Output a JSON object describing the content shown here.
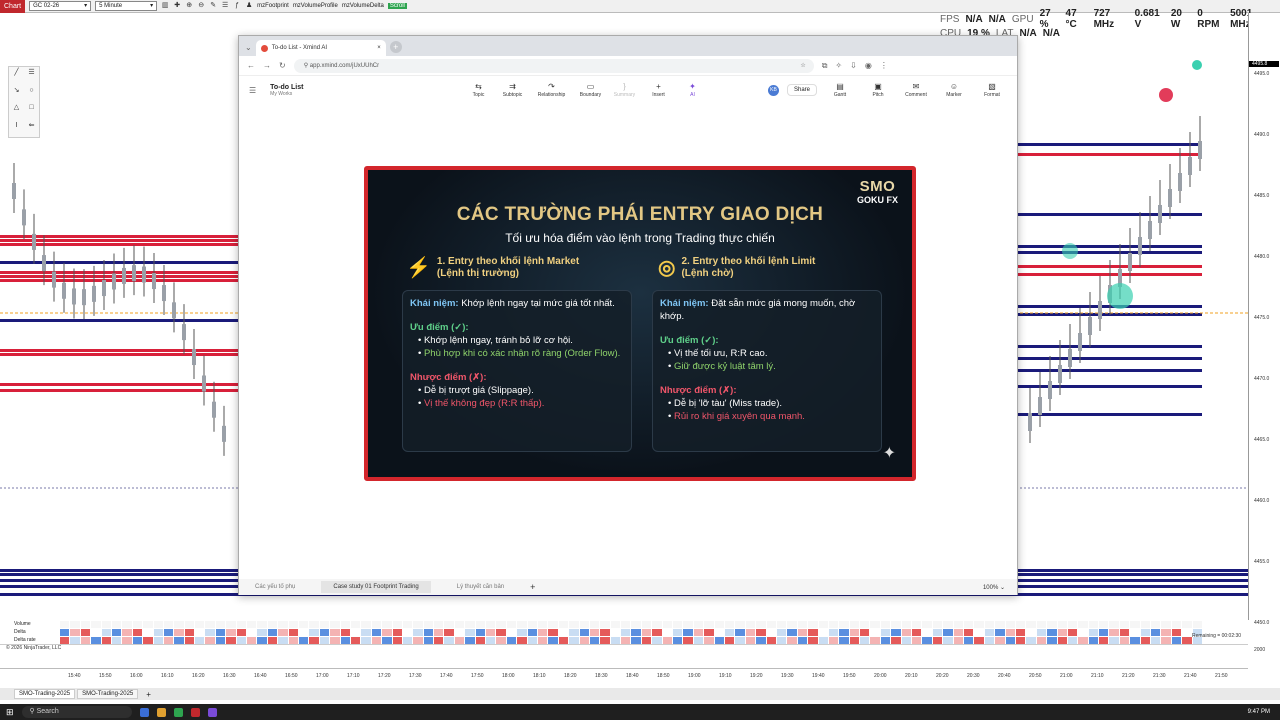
{
  "ninja": {
    "chart_tab": "Chart",
    "instrument": "GC 02-26",
    "timeframe": "5 Minute",
    "indicators": [
      "mzFootprint",
      "mzVolumeProfile",
      "mzVolumeDelta"
    ],
    "scroll_label": "Scroll",
    "copyright": "© 2026 NinjaTrader, LLC",
    "workspace_tabs": [
      "SMO-Trading-2025",
      "SMO-Trading-2025"
    ],
    "add_tab": "+",
    "row_labels": [
      "Volume",
      "Delta",
      "Delta rate"
    ],
    "price_ticks": [
      "4495.0",
      "4490.0",
      "4485.0",
      "4480.0",
      "4475.0",
      "4470.0",
      "4465.0",
      "4460.0",
      "4455.0",
      "4450.0"
    ],
    "current_price": "4495.8",
    "time_ticks": [
      "15:40",
      "15:50",
      "16:00",
      "16:10",
      "16:20",
      "16:30",
      "16:40",
      "16:50",
      "17:00",
      "17:10",
      "17:20",
      "17:30",
      "17:40",
      "17:50",
      "18:00",
      "18:10",
      "18:20",
      "18:30",
      "18:40",
      "18:50",
      "19:00",
      "19:10",
      "19:20",
      "19:30",
      "19:40",
      "19:50",
      "20:00",
      "20:10",
      "20:20",
      "20:30",
      "20:40",
      "20:50",
      "21:00",
      "21:10",
      "21:20",
      "21:30",
      "21:40",
      "21:50"
    ],
    "right_axis_bottom": "2000",
    "remaining_label": "Remaining = 00:02:30"
  },
  "perf": {
    "fps_label": "FPS",
    "fps_value": "N/A",
    "fps_value2": "N/A",
    "gpu_label": "GPU",
    "gpu_load": "27 %",
    "gpu_temp": "47 °C",
    "gpu_clock": "727 MHz",
    "gpu_volt": "0.681 V",
    "gpu_power": "20 W",
    "gpu_rpm": "0 RPM",
    "gpu_mem": "5001 MHz",
    "cpu_label": "CPU",
    "cpu_load": "19 %",
    "lat_label": "LAT",
    "lat_value": "N/A",
    "lat_value2": "N/A"
  },
  "browser": {
    "tab_title": "To-do List - Xmind AI",
    "url": "app.xmind.com/jUxUUhCr",
    "new_tab": "+"
  },
  "xmind": {
    "doc_title": "To-do List",
    "doc_sub": "My Works",
    "tools": [
      {
        "label": "Topic",
        "icon": "⇆"
      },
      {
        "label": "Subtopic",
        "icon": "⇉"
      },
      {
        "label": "Relationship",
        "icon": "↷"
      },
      {
        "label": "Boundary",
        "icon": "▭"
      },
      {
        "label": "Summary",
        "icon": "}"
      },
      {
        "label": "Insert",
        "icon": "+"
      },
      {
        "label": "AI",
        "icon": "✦"
      }
    ],
    "share": "Share",
    "avatar": "KB",
    "right_tools": [
      {
        "label": "Gantt",
        "icon": "▤"
      },
      {
        "label": "Pitch",
        "icon": "▣"
      },
      {
        "label": "Comment",
        "icon": "✉"
      },
      {
        "label": "Marker",
        "icon": "☺"
      },
      {
        "label": "Format",
        "icon": "▧"
      }
    ],
    "sheet_tabs": [
      "Các yếu tố phụ",
      "Case study 01 Footprint Trading",
      "Lý thuyết căn bản"
    ],
    "add_sheet": "+",
    "zoom": "100%"
  },
  "slide": {
    "logo_main": "SMO",
    "logo_sub": "GOKU FX",
    "title": "CÁC TRƯỜNG PHÁI ENTRY GIAO DỊCH",
    "subtitle": "Tối ưu hóa điểm vào lệnh trong Trading thực chiến",
    "col1": {
      "head1": "1. Entry theo khối lệnh Market",
      "head2": "(Lệnh thị trường)",
      "concept_label": "Khái niệm:",
      "concept": "Khớp lệnh ngay tại mức giá tốt nhất.",
      "adv_label": "Ưu điểm (✓):",
      "adv": [
        "Khớp lệnh ngay, tránh bỏ lỡ cơ hội.",
        "Phù hợp khi có xác nhận rõ ràng (Order Flow)."
      ],
      "dis_label": "Nhược điểm (✗):",
      "dis": [
        "Dễ bị trượt giá (Slippage).",
        "Vị thế không đẹp (R:R thấp)."
      ]
    },
    "col2": {
      "head1": "2. Entry theo khối lệnh Limit",
      "head2": "(Lệnh chờ)",
      "concept_label": "Khái niệm:",
      "concept": "Đặt sẵn mức giá mong muốn, chờ khớp.",
      "adv_label": "Ưu điểm (✓):",
      "adv": [
        "Vị thế tối ưu, R:R cao.",
        "Giữ được kỷ luật tâm lý."
      ],
      "dis_label": "Nhược điểm (✗):",
      "dis": [
        "Dễ bị 'lỡ tàu' (Miss trade).",
        "Rủi ro khi giá xuyên qua mạnh."
      ]
    }
  },
  "taskbar": {
    "search": "Search",
    "clock": "9:47 PM"
  }
}
